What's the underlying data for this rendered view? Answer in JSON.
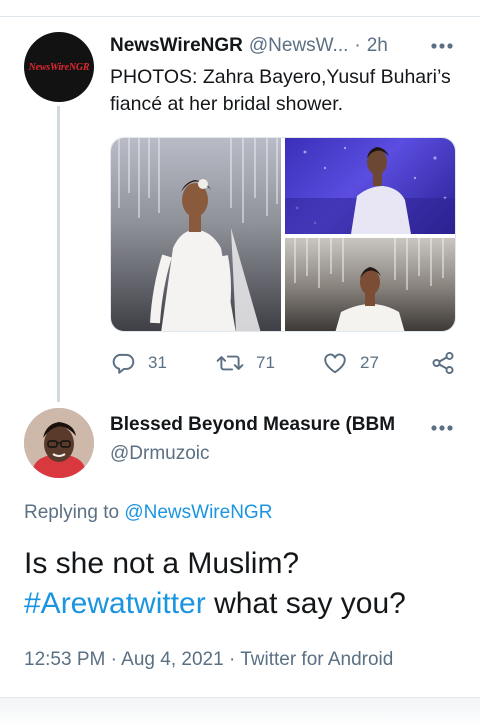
{
  "parent_tweet": {
    "author_name": "NewsWireNGR",
    "author_handle": "@NewsW...",
    "separator": "·",
    "time": "2h",
    "avatar_logo": "NewsWireNGR",
    "text": "PHOTOS: Zahra Bayero,Yusuf Buhari’s fiancé at her bridal shower.",
    "actions": {
      "reply_count": "31",
      "retweet_count": "71",
      "like_count": "27"
    }
  },
  "reply_tweet": {
    "author_name": "Blessed Beyond Measure (BBM",
    "author_handle": "@Drmuzoic",
    "replying_to_prefix": "Replying to",
    "replying_to_handle": "@NewsWireNGR",
    "text_plain": "Is she not a Muslim?",
    "text_hashtag": "#Arewatwitter",
    "text_rest": "what say you?",
    "time": "12:53 PM",
    "separator_1": "·",
    "date": "Aug 4, 2021",
    "separator_2": "·",
    "client": "Twitter for Android"
  },
  "icons": {
    "more": "more-horizontal-icon",
    "reply": "reply-icon",
    "retweet": "retweet-icon",
    "like": "heart-icon",
    "share": "share-icon"
  },
  "colors": {
    "link": "#1b95e0",
    "secondary_text": "#5b7083",
    "primary_text": "#14171a",
    "divider": "#e1e8ed"
  }
}
